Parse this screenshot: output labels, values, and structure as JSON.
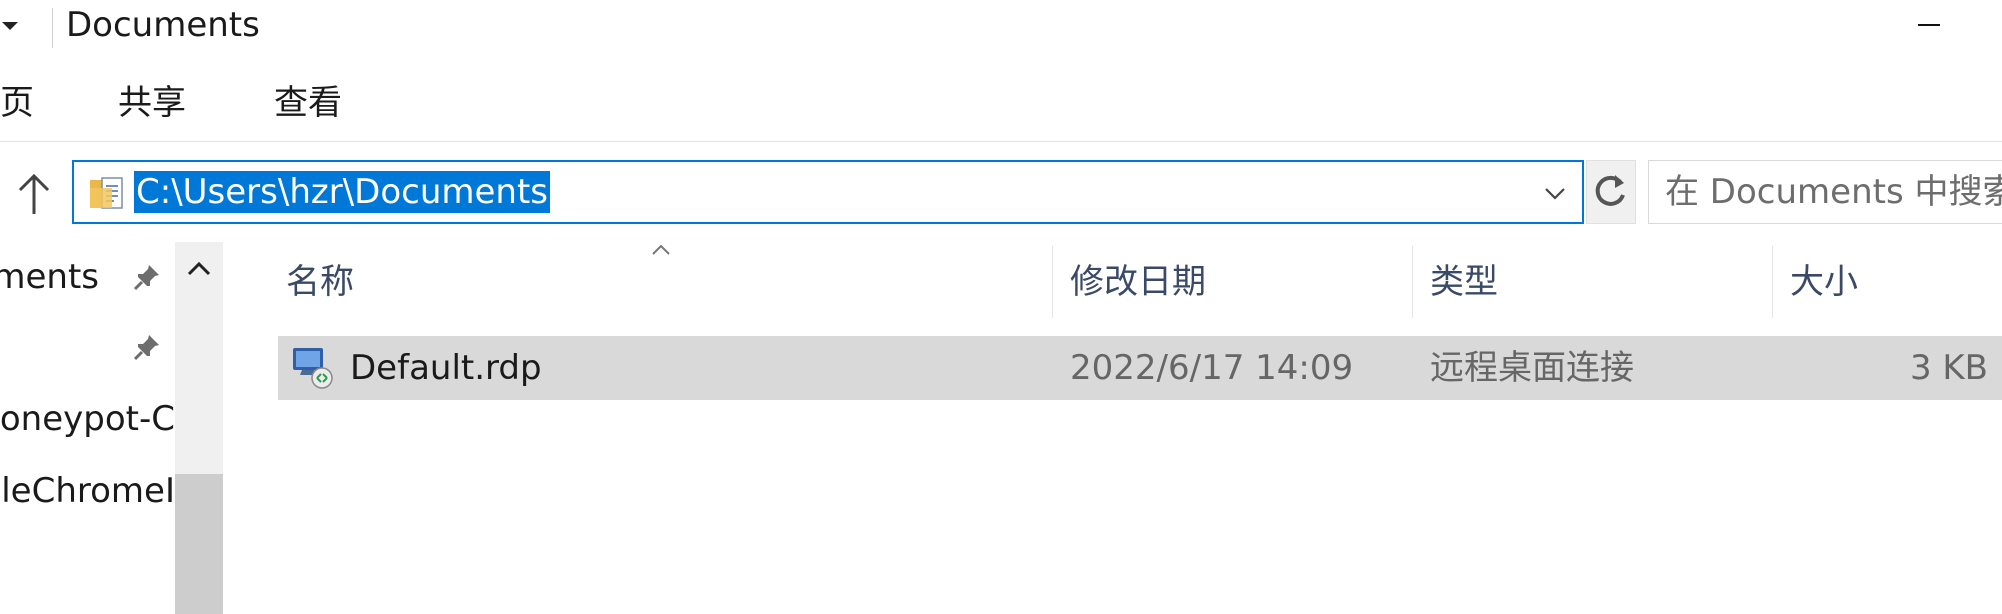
{
  "window": {
    "title": "Documents"
  },
  "ribbon": {
    "tabs": [
      {
        "label": "页"
      },
      {
        "label": "共享"
      },
      {
        "label": "查看"
      }
    ]
  },
  "address_bar": {
    "path": "C:\\Users\\hzr\\Documents",
    "search_placeholder": "在 Documents 中搜索"
  },
  "nav_pane": {
    "items": [
      {
        "label": "ments",
        "pinned": true
      },
      {
        "label": "",
        "pinned": true
      },
      {
        "label": "oneypot-C",
        "pinned": false
      },
      {
        "label": "leChromeI",
        "pinned": false
      }
    ]
  },
  "file_list": {
    "columns": [
      {
        "label": "名称"
      },
      {
        "label": "修改日期"
      },
      {
        "label": "类型"
      },
      {
        "label": "大小"
      }
    ],
    "rows": [
      {
        "name": "Default.rdp",
        "modified": "2022/6/17 14:09",
        "type": "远程桌面连接",
        "size": "3 KB",
        "icon": "remote-desktop-icon",
        "selected": true
      }
    ]
  },
  "colors": {
    "accent": "#0078d7",
    "selection_row": "#d9d9d9",
    "header_text": "#3a4a66"
  }
}
